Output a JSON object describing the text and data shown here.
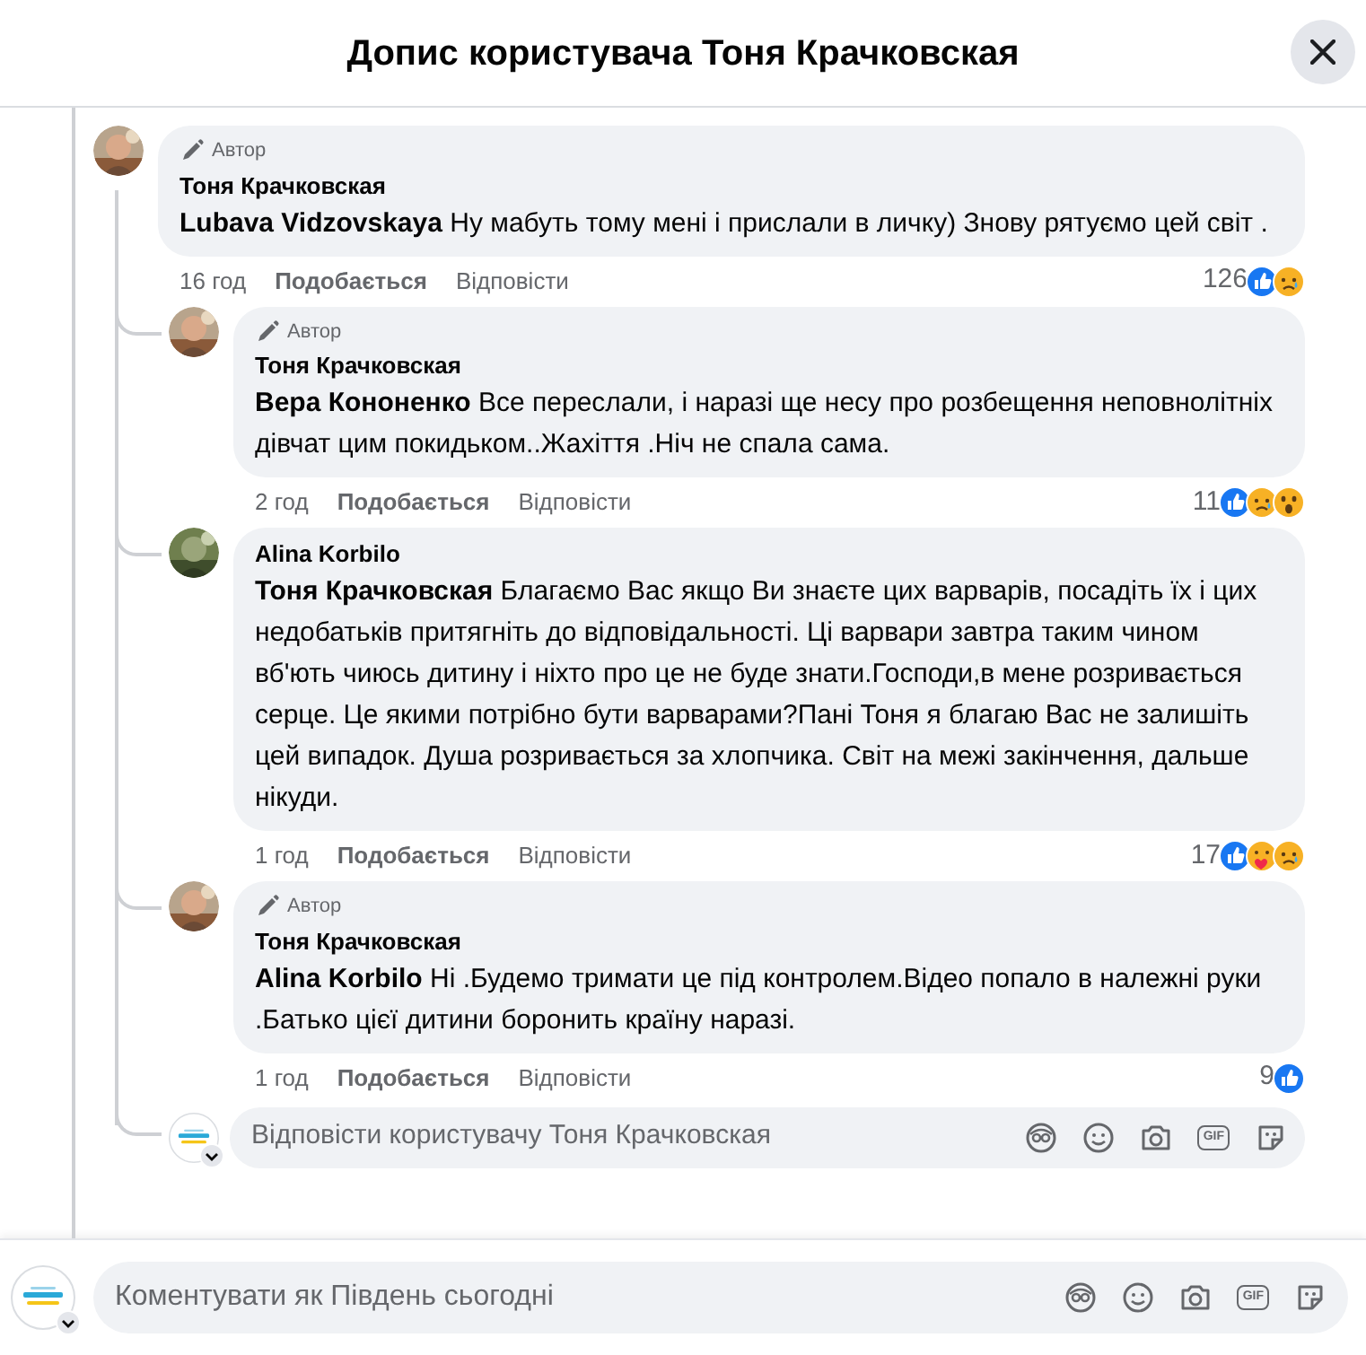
{
  "header": {
    "title": "Допис користувача Тоня Крачковская"
  },
  "comments": [
    {
      "badge": "Автор",
      "author": "Тоня Крачковская",
      "mention": "Lubava Vidzovskaya",
      "text": "Ну мабуть тому мені і прислали в личку) Знову рятуємо цей світ .",
      "time": "16 год",
      "like_label": "Подобається",
      "reply_label": "Відповісти",
      "reaction_count": "126",
      "reactions": [
        {
          "kind": "like"
        },
        {
          "kind": "sad"
        }
      ],
      "children": [
        {
          "badge": "Автор",
          "author": "Тоня Крачковская",
          "mention": "Вера Кононенко",
          "text": "Все переслали, і наразі ще несу про розбещення неповнолітніх дівчат цим покидьком..Жахіття .Ніч не спала сама.",
          "time": "2 год",
          "like_label": "Подобається",
          "reply_label": "Відповісти",
          "reaction_count": "11",
          "reactions": [
            {
              "kind": "like"
            },
            {
              "kind": "sad"
            },
            {
              "kind": "wow"
            }
          ]
        },
        {
          "author": "Alina Korbilo",
          "mention": "Тоня Крачковская",
          "text": "Благаємо Вас якщо Ви знаєте цих варварів, посадіть їх і цих недобатьків притягніть до відповідальності. Ці варвари завтра таким чином вб'ють чиюсь дитину і ніхто про це не буде знати.Господи,в мене розривається серце. Це якими потрібно бути варварами?Пані Тоня я благаю Вас не залишіть цей випадок. Душа розривається за хлопчика. Світ на межі закінчення, дальше нікуди.",
          "time": "1 год",
          "like_label": "Подобається",
          "reply_label": "Відповісти",
          "reaction_count": "17",
          "reactions": [
            {
              "kind": "like"
            },
            {
              "kind": "care"
            },
            {
              "kind": "sad"
            }
          ]
        },
        {
          "badge": "Автор",
          "author": "Тоня Крачковская",
          "mention": "Alina Korbilo",
          "text": "Ні .Будемо тримати це під контролем.Відео попало в належні руки .Батько цієї дитини боронить країну наразі.",
          "time": "1 год",
          "like_label": "Подобається",
          "reply_label": "Відповісти",
          "reaction_count": "9",
          "reactions": [
            {
              "kind": "like"
            }
          ]
        }
      ],
      "reply_box": {
        "placeholder": "Відповісти користувачу Тоня Крачковская",
        "gif_label": "GIF"
      }
    }
  ],
  "comment_box": {
    "placeholder": "Коментувати як Південь сьогодні",
    "gif_label": "GIF"
  }
}
